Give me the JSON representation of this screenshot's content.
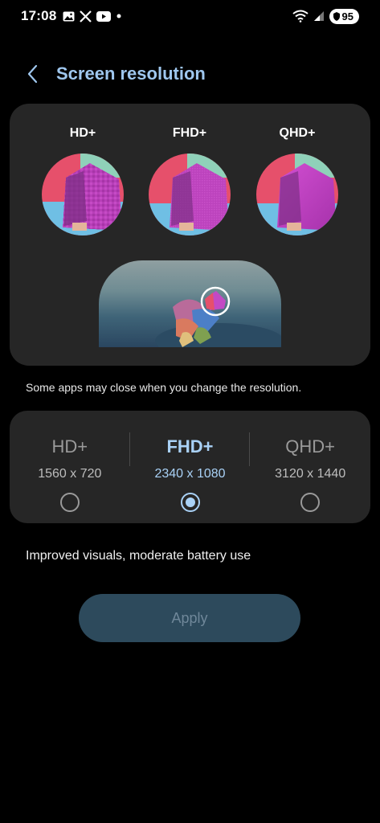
{
  "status_bar": {
    "time": "17:08",
    "battery": "95",
    "left_icons": [
      "gallery-icon",
      "x-icon",
      "youtube-icon",
      "dot-icon"
    ],
    "right_icons": [
      "wifi-icon",
      "signal-icon",
      "battery-icon"
    ]
  },
  "header": {
    "title": "Screen resolution",
    "back_icon": "chevron-left-icon"
  },
  "preview": {
    "labels": [
      "HD+",
      "FHD+",
      "QHD+"
    ]
  },
  "info": "Some apps may close when you change the resolution.",
  "options": [
    {
      "name": "HD+",
      "dims": "1560 x 720",
      "selected": false
    },
    {
      "name": "FHD+",
      "dims": "2340 x 1080",
      "selected": true
    },
    {
      "name": "QHD+",
      "dims": "3120 x 1440",
      "selected": false
    }
  ],
  "description": "Improved visuals, moderate battery use",
  "apply_label": "Apply",
  "colors": {
    "accent": "#a9d1f6",
    "title": "#9fc7ee",
    "card": "#262626",
    "apply_bg": "#2d4a5c",
    "apply_text": "#6f8799"
  }
}
